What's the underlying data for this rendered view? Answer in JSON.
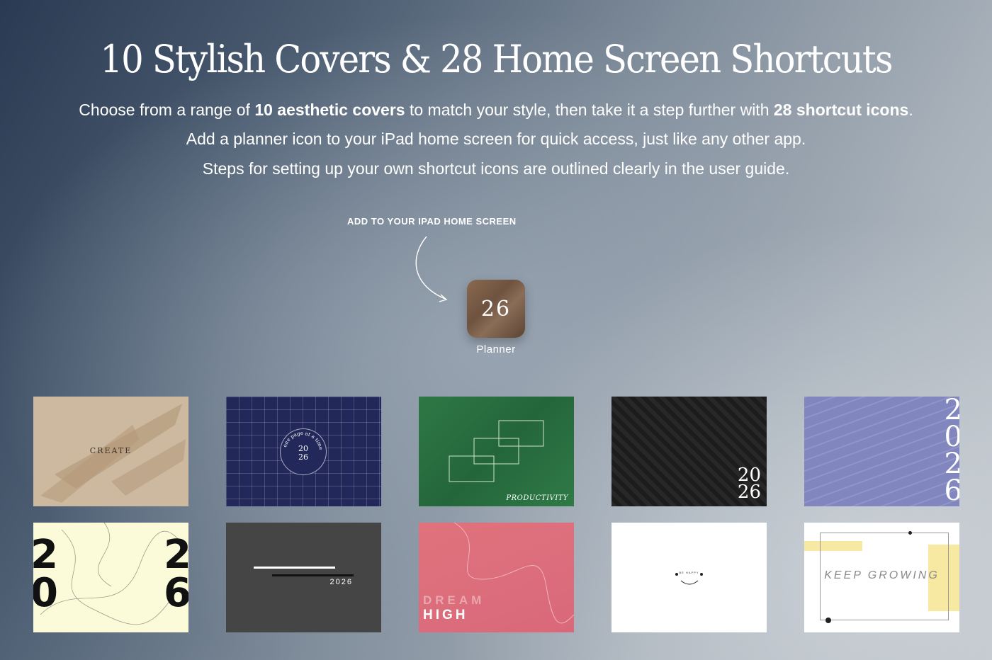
{
  "header": {
    "title": "10 Stylish Covers & 28 Home Screen Shortcuts",
    "line1_a": "Choose from a range of ",
    "line1_b": "10 aesthetic covers",
    "line1_c": " to match your style, then take it a step further with ",
    "line1_d": "28 shortcut icons",
    "line1_e": ".",
    "line2": "Add a planner icon to your iPad home screen for quick access, just like any other app.",
    "line3": "Steps for setting up your own shortcut icons are outlined clearly in the user guide."
  },
  "callout": "ADD TO YOUR IPAD HOME SCREEN",
  "app": {
    "number": "26",
    "label": "Planner"
  },
  "covers": {
    "create": "CREATE",
    "grid_ring_text": "one page at a time",
    "grid_year_a": "20",
    "grid_year_b": "26",
    "productivity": "PRODUCTIVITY",
    "dark_year_a": "20",
    "dark_year_b": "26",
    "purple_year": [
      "2",
      "0",
      "2",
      "6"
    ],
    "cream_digits": [
      "2",
      "2",
      "0",
      "6"
    ],
    "gray_year": "2026",
    "dream": "DREAM",
    "high": "HIGH",
    "be_happy": "BE HAPPY",
    "keep_growing": "KEEP GROWING"
  },
  "colors": {
    "cover_create": "#cdb9a0",
    "cover_grid": "#23285a",
    "cover_green": "#2e7845",
    "cover_dark": "#1c1c1c",
    "cover_purple": "#8186bf",
    "cover_cream": "#fbfbda",
    "cover_gray": "#454545",
    "cover_pink": "#e0727d",
    "cover_yellow_accent": "#f7e9a1"
  }
}
